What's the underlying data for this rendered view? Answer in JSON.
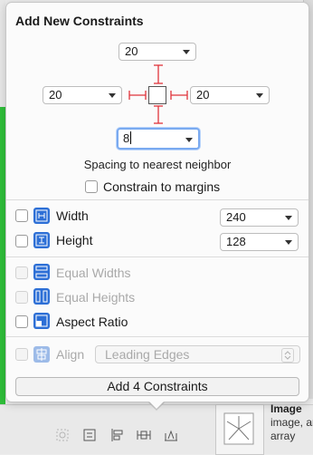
{
  "popover": {
    "title": "Add New Constraints",
    "spacing": {
      "top": "20",
      "left": "20",
      "right": "20",
      "bottom": "8",
      "caption": "Spacing to nearest neighbor"
    },
    "constrain_to_margins": "Constrain to margins",
    "width": {
      "label": "Width",
      "value": "240"
    },
    "height": {
      "label": "Height",
      "value": "128"
    },
    "equal_widths": "Equal Widths",
    "equal_heights": "Equal Heights",
    "aspect_ratio": "Aspect Ratio",
    "align": {
      "label": "Align",
      "value": "Leading Edges"
    },
    "add_button": "Add 4 Constraints"
  },
  "library": {
    "title": "Image",
    "description": "image, an array"
  },
  "icons": {
    "width": "width-constraint-icon",
    "height": "height-constraint-icon",
    "equal_widths": "equal-widths-icon",
    "equal_heights": "equal-heights-icon",
    "aspect_ratio": "aspect-ratio-icon",
    "align": "align-icon"
  },
  "colors": {
    "accent": "#2d6fd6",
    "constraint_red": "#e0333b",
    "focus_ring": "#7aaaf0"
  }
}
